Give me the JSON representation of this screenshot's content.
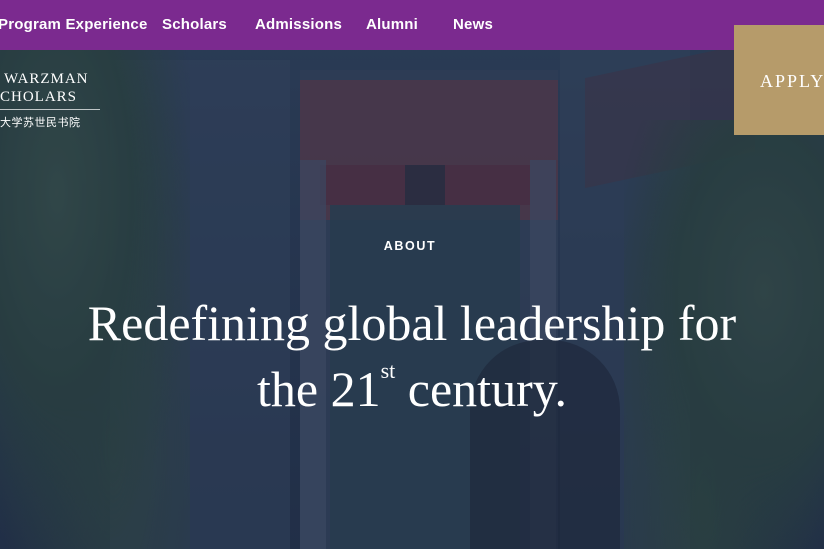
{
  "nav": {
    "items": [
      {
        "label": "Program Experience"
      },
      {
        "label": "Scholars"
      },
      {
        "label": "Admissions"
      },
      {
        "label": "Alumni"
      },
      {
        "label": "News"
      }
    ]
  },
  "logo": {
    "line1": "WARZMAN",
    "line2": "CHOLARS",
    "chinese": "大学苏世民书院"
  },
  "apply": {
    "label": "APPLY"
  },
  "hero": {
    "eyebrow": "ABOUT",
    "headline_line1": "Redefining global leadership for",
    "headline_line2_prefix": "the 21",
    "headline_superscript": "st",
    "headline_line2_suffix": " century."
  },
  "colors": {
    "nav_background": "#7b2a8f",
    "apply_background": "#b69b6a",
    "text": "#ffffff"
  }
}
